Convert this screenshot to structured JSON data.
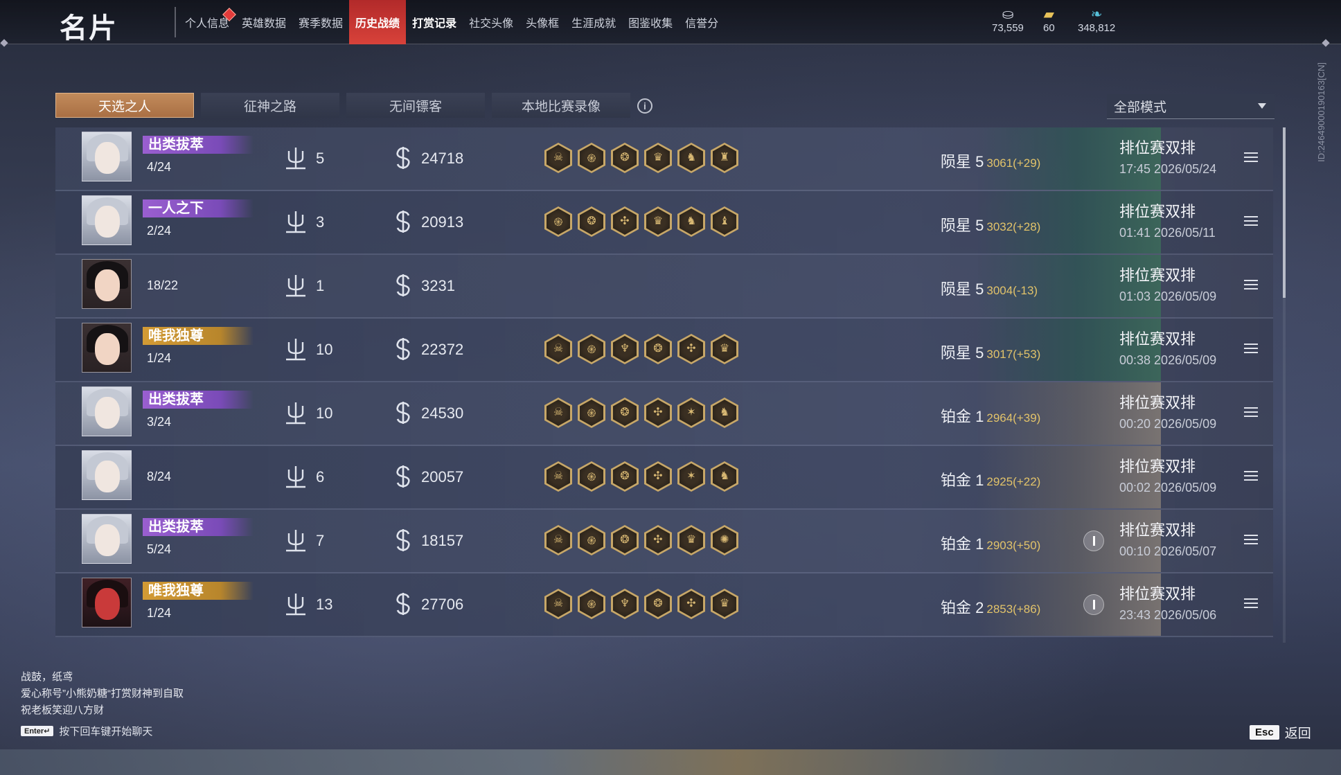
{
  "header": {
    "title": "名片",
    "nav": [
      {
        "label": "个人信息",
        "badge": true
      },
      {
        "label": "英雄数据"
      },
      {
        "label": "赛季数据"
      },
      {
        "label": "历史战绩",
        "active": true
      },
      {
        "label": "打赏记录",
        "bright": true
      },
      {
        "label": "社交头像"
      },
      {
        "label": "头像框"
      },
      {
        "label": "生涯成就"
      },
      {
        "label": "图鉴收集"
      },
      {
        "label": "信誉分"
      }
    ],
    "currencies": [
      {
        "icon": "coin-stack-icon",
        "value": "73,559"
      },
      {
        "icon": "ticket-icon",
        "value": "60"
      },
      {
        "icon": "feather-icon",
        "value": "348,812"
      }
    ]
  },
  "tabs": [
    "天选之人",
    "征神之路",
    "无间镖客",
    "本地比赛录像"
  ],
  "mode_select": {
    "value": "全部模式"
  },
  "side_id": "ID:2464900019016​3[CN]",
  "matches": [
    {
      "avatar": "masked",
      "tag": "出类拔萃",
      "tag_color": "purple",
      "placement": "4/24",
      "kills": "5",
      "score": "24718",
      "skills": [
        "☠",
        "֍",
        "❂",
        "♛",
        "♞",
        "♜"
      ],
      "rank_name": "陨星 5",
      "rank_score": "3061(+29)",
      "rank_art": "green",
      "mode": "排位赛双排",
      "time": "17:45  2026/05/24"
    },
    {
      "avatar": "masked",
      "tag": "一人之下",
      "tag_color": "purple",
      "placement": "2/24",
      "kills": "3",
      "score": "20913",
      "skills": [
        "֍",
        "❂",
        "✣",
        "♛",
        "♞",
        "♝"
      ],
      "rank_name": "陨星 5",
      "rank_score": "3032(+28)",
      "rank_art": "green",
      "mode": "排位赛双排",
      "time": "01:41  2026/05/11"
    },
    {
      "avatar": "dark",
      "tag": "",
      "tag_color": "",
      "placement": "18/22",
      "kills": "1",
      "score": "3231",
      "skills": [],
      "rank_name": "陨星 5",
      "rank_score": "3004(-13)",
      "rank_art": "green",
      "mode": "排位赛双排",
      "time": "01:03  2026/05/09"
    },
    {
      "avatar": "dark",
      "tag": "唯我独尊",
      "tag_color": "gold",
      "placement": "1/24",
      "kills": "10",
      "score": "22372",
      "skills": [
        "☠",
        "֍",
        "♆",
        "❂",
        "✣",
        "♛"
      ],
      "rank_name": "陨星 5",
      "rank_score": "3017(+53)",
      "rank_art": "green",
      "mode": "排位赛双排",
      "time": "00:38  2026/05/09"
    },
    {
      "avatar": "masked",
      "tag": "出类拔萃",
      "tag_color": "purple",
      "placement": "3/24",
      "kills": "10",
      "score": "24530",
      "skills": [
        "☠",
        "֍",
        "❂",
        "✣",
        "✶",
        "♞"
      ],
      "rank_name": "铂金 1",
      "rank_score": "2964(+39)",
      "rank_art": "plat",
      "mode": "排位赛双排",
      "time": "00:20  2026/05/09"
    },
    {
      "avatar": "masked",
      "tag": "",
      "tag_color": "",
      "placement": "8/24",
      "kills": "6",
      "score": "20057",
      "skills": [
        "☠",
        "֍",
        "❂",
        "✣",
        "✶",
        "♞"
      ],
      "rank_name": "铂金 1",
      "rank_score": "2925(+22)",
      "rank_art": "plat",
      "mode": "排位赛双排",
      "time": "00:02  2026/05/09"
    },
    {
      "avatar": "masked",
      "tag": "出类拔萃",
      "tag_color": "purple",
      "placement": "5/24",
      "kills": "7",
      "score": "18157",
      "skills": [
        "☠",
        "֍",
        "❂",
        "✣",
        "♛",
        "✺"
      ],
      "rank_name": "铂金 1",
      "rank_score": "2903(+50)",
      "rank_art": "plat",
      "mode": "排位赛双排",
      "time": "00:10  2026/05/07"
    },
    {
      "avatar": "red",
      "tag": "唯我独尊",
      "tag_color": "gold",
      "placement": "1/24",
      "kills": "13",
      "score": "27706",
      "skills": [
        "☠",
        "֍",
        "♆",
        "❂",
        "✣",
        "♛"
      ],
      "rank_name": "铂金 2",
      "rank_score": "2853(+86)",
      "rank_art": "plat",
      "mode": "排位赛双排",
      "time": "23:43  2026/05/06"
    }
  ],
  "chat": {
    "lines": [
      "战鼓，纸鸢",
      "爱心称号”小熊奶糖“打赏财神到自取",
      "祝老板笑迎八方财"
    ],
    "enter_key": "Enter↵",
    "hint": "按下回车键开始聊天"
  },
  "footer": {
    "esc_key": "Esc",
    "back_label": "返回"
  }
}
